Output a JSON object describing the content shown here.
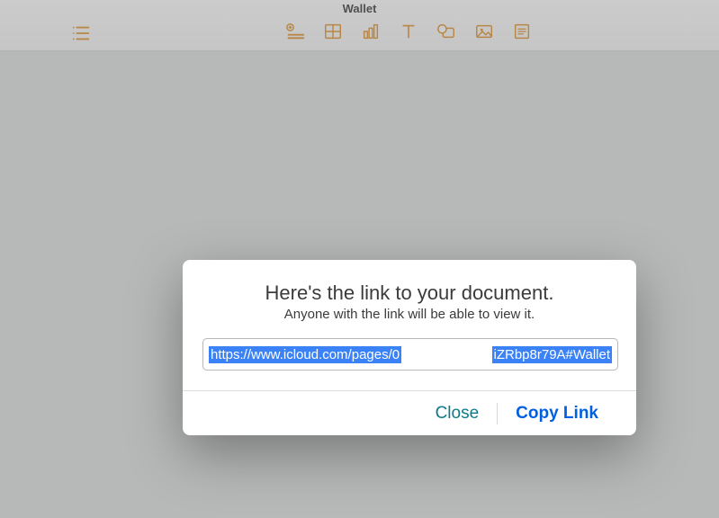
{
  "header": {
    "title": "Wallet",
    "icons": {
      "view": "list-icon",
      "insert": "plus-row-icon",
      "table": "table-icon",
      "chart": "chart-icon",
      "text": "text-icon",
      "shape": "shape-icon",
      "media": "media-icon",
      "comment": "comment-icon"
    }
  },
  "dialog": {
    "title": "Here's the link to your document.",
    "subtitle": "Anyone with the link will be able to view it.",
    "link_left": "https://www.icloud.com/pages/0",
    "link_right": "iZRbp8r79A#Wallet",
    "close_label": "Close",
    "copy_label": "Copy Link"
  }
}
